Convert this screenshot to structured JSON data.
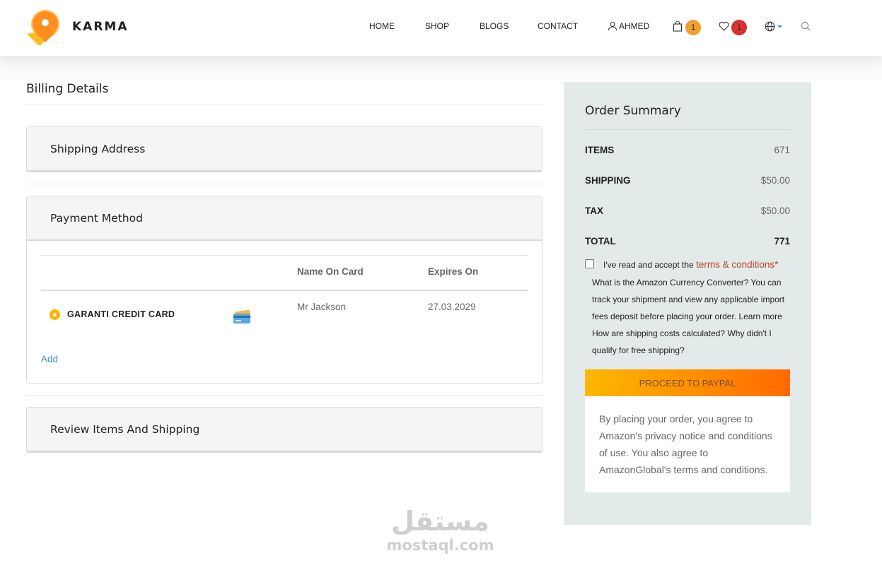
{
  "brand": {
    "name": "KARMA"
  },
  "nav": {
    "home": "HOME",
    "shop": "SHOP",
    "blogs": "BLOGS",
    "contact": "CONTACT",
    "user": "AHMED",
    "cart_count": "1",
    "wishlist_count": "1"
  },
  "billing": {
    "title": "Billing Details",
    "shipping_address": "Shipping Address",
    "payment_method": "Payment Method",
    "review": "Review Items And Shipping",
    "table": {
      "col_name": "Name On Card",
      "col_expires": "Expires On",
      "card_label": "GARANTI CREDIT CARD",
      "name_on_card": "Mr Jackson",
      "expires_on": "27.03.2029"
    },
    "add": "Add"
  },
  "summary": {
    "title": "Order Summary",
    "rows": [
      {
        "label": "ITEMS",
        "value": "671"
      },
      {
        "label": "SHIPPING",
        "value": "$50.00"
      },
      {
        "label": "TAX",
        "value": "$50.00"
      },
      {
        "label": "TOTAL",
        "value": "771"
      }
    ],
    "accept_text": "I've read and accept the",
    "terms_link": "terms & conditions*",
    "faq": "What is the Amazon Currency Converter? You can track your shipment and view any applicable import fees deposit before placing your order. Learn more How are shipping costs calculated? Why didn't I qualify for free shipping?",
    "paypal_button": "PROCEED TO PAYPAL",
    "agree_text": "By placing your order, you agree to Amazon's privacy notice and conditions of use. You also agree to AmazonGlobal's terms and conditions."
  },
  "watermark": {
    "arabic": "مستقل",
    "latin": "mostaql.com"
  },
  "colors": {
    "accent": "#ffb300",
    "accent_end": "#ff6a00",
    "summary_bg": "#e3eaea",
    "terms": "#c0462b",
    "link": "#3a8dde"
  }
}
